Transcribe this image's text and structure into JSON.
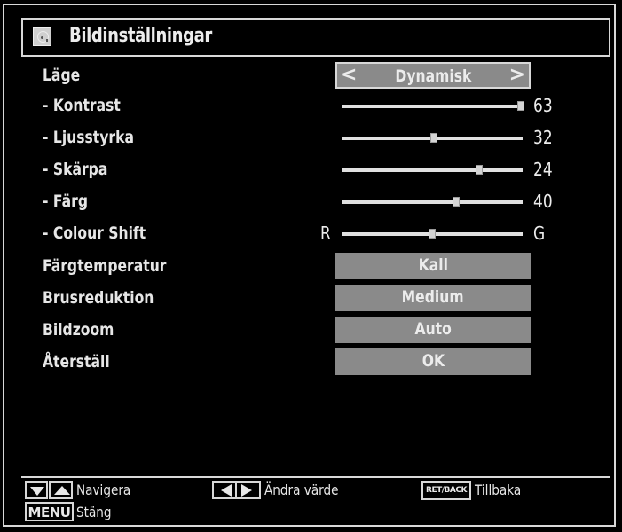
{
  "menu": {
    "title": "Bildinställningar",
    "title_icon": "picture-settings-icon",
    "items": [
      {
        "label": "Läge",
        "type": "selector",
        "value": "Dynamisk",
        "selected": true,
        "left_arrow": "<",
        "right_arrow": ">"
      },
      {
        "label": "- Kontrast",
        "type": "slider",
        "value": "63",
        "position": 0.99
      },
      {
        "label": "- Ljusstyrka",
        "type": "slider",
        "value": "32",
        "position": 0.51
      },
      {
        "label": "- Skärpa",
        "type": "slider",
        "value": "24",
        "position": 0.76
      },
      {
        "label": "- Färg",
        "type": "slider",
        "value": "40",
        "position": 0.63
      },
      {
        "label": "- Colour Shift",
        "type": "balance-slider",
        "min_label": "R",
        "max_label": "G",
        "position": 0.5
      },
      {
        "label": "Färgtemperatur",
        "type": "option",
        "value": "Kall"
      },
      {
        "label": "Brusreduktion",
        "type": "option",
        "value": "Medium"
      },
      {
        "label": "Bildzoom",
        "type": "option",
        "value": "Auto"
      },
      {
        "label": "Återställ",
        "type": "option",
        "value": "OK"
      }
    ]
  },
  "footer": {
    "navigate": {
      "keys": [
        "down-arrow-key",
        "up-arrow-key"
      ],
      "label": "Navigera"
    },
    "change_value": {
      "keys": [
        "left-arrow-key",
        "right-arrow-key"
      ],
      "label": "Ändra värde"
    },
    "back": {
      "key": "RET/BACK",
      "label": "Tillbaka"
    },
    "close": {
      "key": "MENU",
      "label": "Stäng"
    }
  },
  "colors": {
    "background": "#000000",
    "frame": "#d8d8d8",
    "value_box": "#8a8a8a",
    "text": "#e8e8e8"
  }
}
